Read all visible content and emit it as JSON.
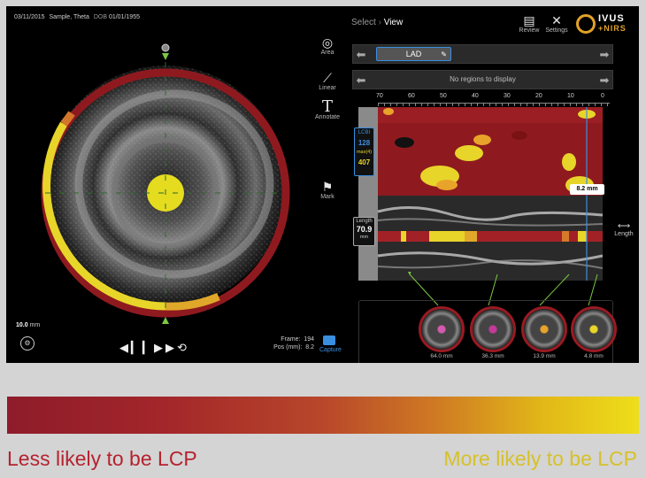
{
  "header": {
    "date": "03/11/2015",
    "patient": "Sample, Theta",
    "dob_label": "DOB",
    "dob": "01/01/1955"
  },
  "breadcrumb": {
    "select": "Select",
    "separator": "›",
    "view": "View"
  },
  "toolbar": {
    "review_label": "Review",
    "settings_label": "Settings"
  },
  "logo": {
    "line1": "IVUS",
    "line2": "+NIRS",
    "symbol": "+"
  },
  "tools": {
    "area_label": "Area",
    "linear_label": "Linear",
    "annotate_label": "Annotate",
    "annotate_glyph": "T",
    "mark_label": "Mark"
  },
  "vessel": {
    "name": "LAD"
  },
  "regions": {
    "message": "No regions to display"
  },
  "axis": {
    "ticks": [
      "70",
      "60",
      "50",
      "40",
      "30",
      "20",
      "10",
      "0"
    ]
  },
  "lcb": {
    "label": "LCBI",
    "value": "128",
    "max_label": "max(4)",
    "max_value": "407"
  },
  "marker": {
    "position": "8.2 mm"
  },
  "length": {
    "label": "Length",
    "value": "70.9",
    "unit": "mm",
    "right_label": "Length"
  },
  "scale": {
    "value": "10.0",
    "unit": "mm"
  },
  "frame": {
    "frame_label": "Frame:",
    "frame_value": "194",
    "pos_label": "Pos (mm):",
    "pos_value": "8.2"
  },
  "capture_label": "Capture",
  "thumbnails": [
    {
      "label": "64.0 mm"
    },
    {
      "label": "36.3 mm"
    },
    {
      "label": "13.9 mm"
    },
    {
      "label": "4.8 mm"
    }
  ],
  "legend": {
    "left": "Less likely to be LCP",
    "right": "More likely to be LCP",
    "left_color": "#b5222f",
    "right_color": "#d6c12a"
  },
  "colors": {
    "chemogram_red": "#8e1a1f",
    "lipid_yellow": "#e8d52a",
    "accent_blue": "#3a8fe0"
  }
}
